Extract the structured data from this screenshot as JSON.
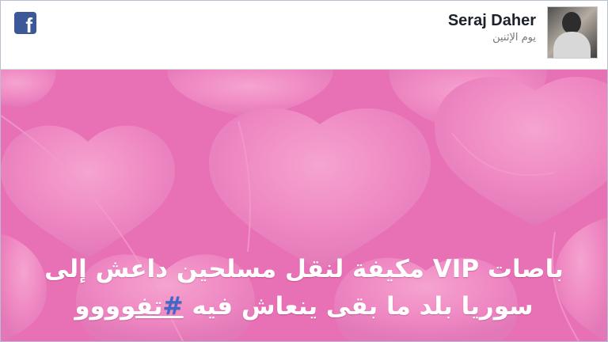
{
  "header": {
    "name": "Seraj Daher",
    "timestamp": "يوم الإثنين",
    "icons": [
      "facebook-icon",
      "avatar"
    ]
  },
  "post": {
    "line1": "باصات VIP مكيفة لنقل مسلحين داعش إلى",
    "line2_text": "سوريا بلد ما بقى ينعاش فيه ",
    "hashtag_mark": "#",
    "hashtag_text": "تفوووو"
  },
  "colors": {
    "background_pink": "#e870b5",
    "heart_pink": "#f08ac4",
    "facebook_blue": "#3b5998",
    "hashtag_blue": "#3f69c8"
  }
}
